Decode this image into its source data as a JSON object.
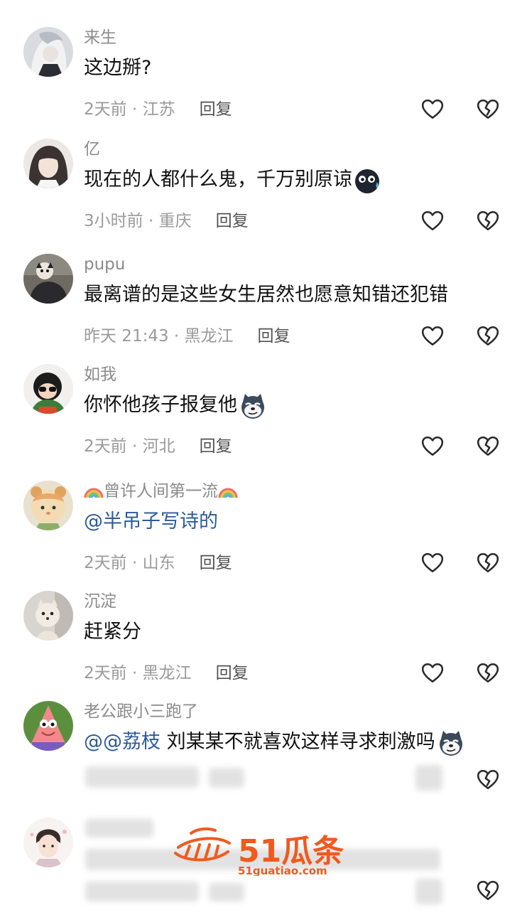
{
  "comments": [
    {
      "username": "来生",
      "text": "这边掰?",
      "time": "2天前",
      "location": "江苏",
      "reply": "回复"
    },
    {
      "username": "亿",
      "text": "现在的人都什么鬼，千万别原谅",
      "time": "3小时前",
      "location": "重庆",
      "reply": "回复",
      "emoji": "sweat-face-emoji"
    },
    {
      "username": "pupu",
      "text": "最离谱的是这些女生居然也愿意知错还犯错",
      "time": "昨天 21:43",
      "location": "黑龙江",
      "reply": "回复"
    },
    {
      "username": "如我",
      "text": "你怀他孩子报复他",
      "time": "2天前",
      "location": "河北",
      "reply": "回复",
      "emoji": "husky-emoji"
    },
    {
      "username": "曾许人间第一流",
      "text": "@半吊子写诗的",
      "time": "2天前",
      "location": "山东",
      "reply": "回复",
      "username_emoji": "rainbow-emoji"
    },
    {
      "username": "沉淀",
      "text": "赶紧分",
      "time": "2天前",
      "location": "黑龙江",
      "reply": "回复"
    },
    {
      "username": "老公跟小三跑了",
      "mention": "@@荔枝",
      "text": "刘某某不就喜欢这样寻求刺激吗",
      "reply": "回复",
      "emoji": "husky-emoji"
    }
  ],
  "meta_separator": " · ",
  "icons": {
    "like": "heart-outline-icon",
    "dislike": "broken-heart-icon"
  },
  "watermark": {
    "brand": "51瓜条",
    "site": "51guatiao.com",
    "color": "#f05a1e"
  },
  "colors": {
    "username": "#8b8b8b",
    "mention": "#2c5a9c",
    "meta": "#9a9a9a"
  }
}
